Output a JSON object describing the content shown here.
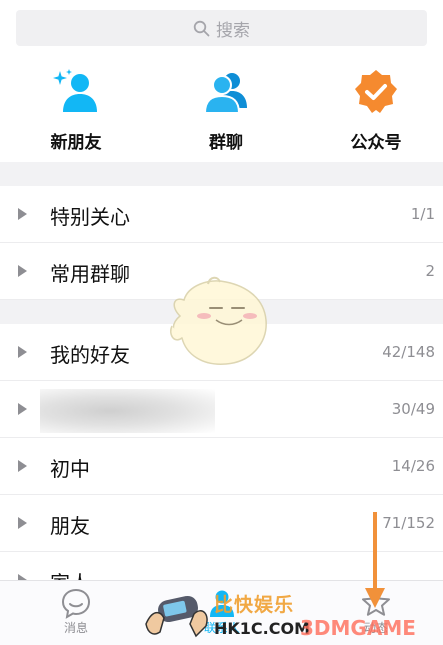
{
  "search": {
    "placeholder": "搜索"
  },
  "shortcuts": [
    {
      "label": "新朋友",
      "icon": "new-friend-icon"
    },
    {
      "label": "群聊",
      "icon": "group-chat-icon"
    },
    {
      "label": "公众号",
      "icon": "official-account-icon"
    }
  ],
  "groups": [
    {
      "name": "特别关心",
      "count": "1/1"
    },
    {
      "name": "常用群聊",
      "count": "2"
    },
    {
      "name": "我的好友",
      "count": "42/148"
    },
    {
      "name": "",
      "count": "30/49"
    },
    {
      "name": "初中",
      "count": "14/26"
    },
    {
      "name": "朋友",
      "count": "71/152"
    },
    {
      "name": "家人",
      "count": ""
    }
  ],
  "tabbar": {
    "messages_label": "消息",
    "contacts_label": "联系人",
    "dynamics_label": "动态"
  },
  "watermark": {
    "brand_cn": "比快娱乐",
    "site": "HK1C.COM",
    "site2": "3DMGAME"
  },
  "colors": {
    "accent": "#12b7f5",
    "orange": "#f58a2f",
    "arrow": "#f1913a"
  }
}
